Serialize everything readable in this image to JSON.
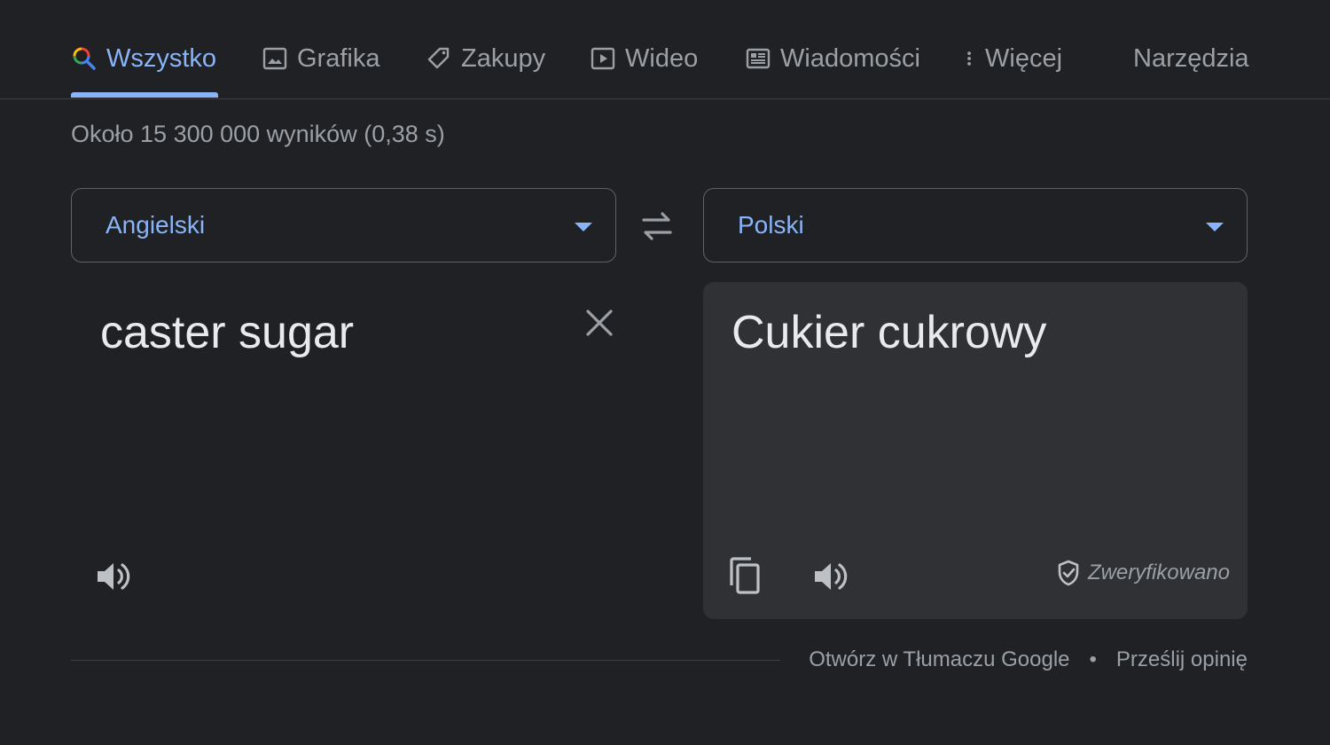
{
  "tabs": [
    {
      "label": "Wszystko",
      "icon": "search-icon",
      "active": true
    },
    {
      "label": "Grafika",
      "icon": "image-icon"
    },
    {
      "label": "Zakupy",
      "icon": "tag-icon"
    },
    {
      "label": "Wideo",
      "icon": "video-icon"
    },
    {
      "label": "Wiadomości",
      "icon": "news-icon"
    },
    {
      "label": "Więcej",
      "icon": "more-vert-icon"
    }
  ],
  "tools_label": "Narzędzia",
  "result_stats": "Około 15 300 000 wyników (0,38 s)",
  "translator": {
    "source_language": "Angielski",
    "target_language": "Polski",
    "source_text": "caster sugar",
    "target_text": "Cukier cukrowy",
    "verified_label": "Zweryfikowano"
  },
  "footer": {
    "open_link": "Otwórz w Tłumaczu Google",
    "separator": "•",
    "feedback_link": "Prześlij opinię"
  },
  "colors": {
    "background": "#202124",
    "accent": "#8ab4f8",
    "pane": "#303134",
    "text_primary": "#e8eaed",
    "text_secondary": "#9aa0a6"
  }
}
